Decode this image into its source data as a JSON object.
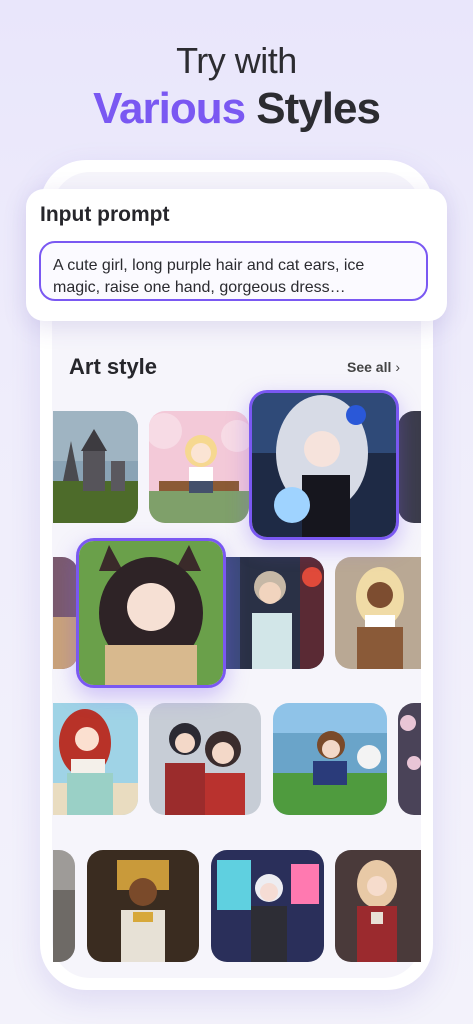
{
  "headline": {
    "line1": "Try with",
    "line2_accent": "Various",
    "line2_rest": "Styles"
  },
  "prompt": {
    "title": "Input prompt",
    "text": "A cute girl, long purple hair and cat ears, ice magic, raise one hand, gorgeous dress…"
  },
  "art_style": {
    "title": "Art style",
    "see_all": "See all",
    "chevron_icon": "chevron-right-icon",
    "accent_color": "#7a58f2"
  }
}
